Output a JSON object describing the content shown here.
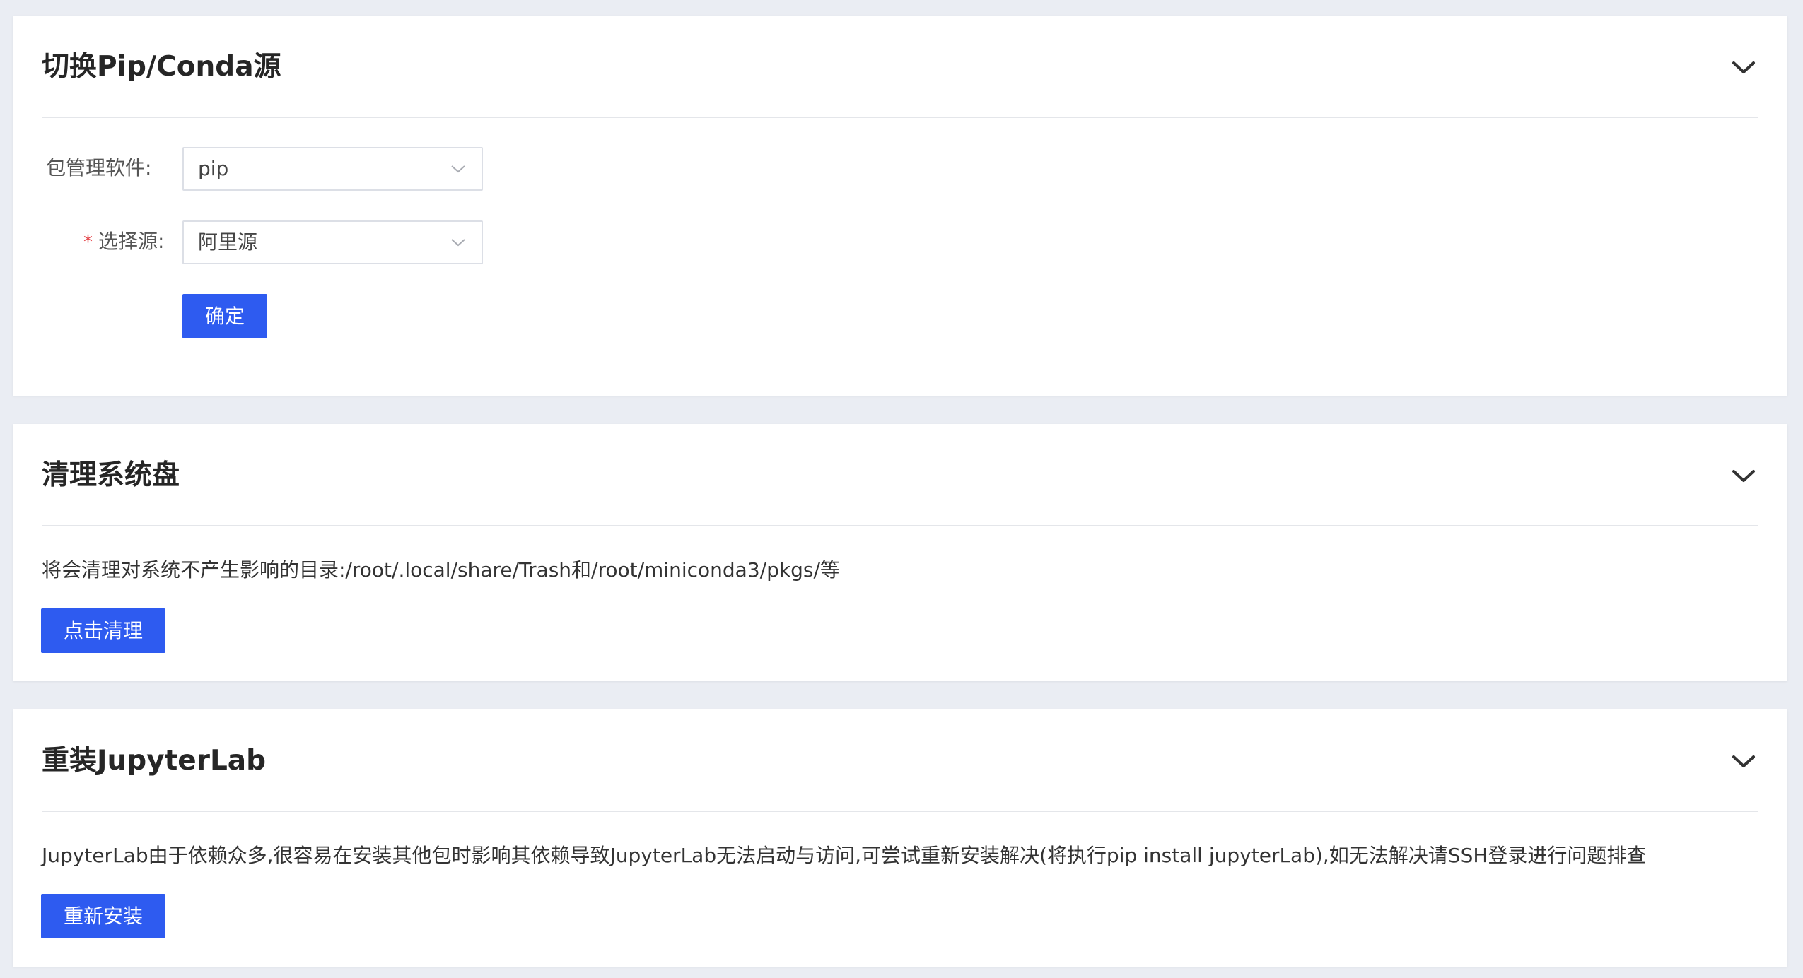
{
  "pip_source": {
    "title": "切换Pip/Conda源",
    "manager_label": "包管理软件:",
    "manager_value": "pip",
    "source_required_mark": "*",
    "source_label": "选择源:",
    "source_value": "阿里源",
    "confirm_button": "确定"
  },
  "clean_disk": {
    "title": "清理系统盘",
    "description": "将会清理对系统不产生影响的目录:/root/.local/share/Trash和/root/miniconda3/pkgs/等",
    "clean_button": "点击清理"
  },
  "reinstall_jupyterlab": {
    "title": "重装JupyterLab",
    "description": "JupyterLab由于依赖众多,很容易在安装其他包时影响其依赖导致JupyterLab无法启动与访问,可尝试重新安装解决(将执行pip install jupyterLab),如无法解决请SSH登录进行问题排查",
    "reinstall_button": "重新安装"
  },
  "icons": {
    "collapse": "chevron-down-icon",
    "select_arrow": "chevron-down-icon"
  },
  "colors": {
    "primary": "#2e5bf0",
    "background": "#eaedf3",
    "required": "#e5484d"
  }
}
